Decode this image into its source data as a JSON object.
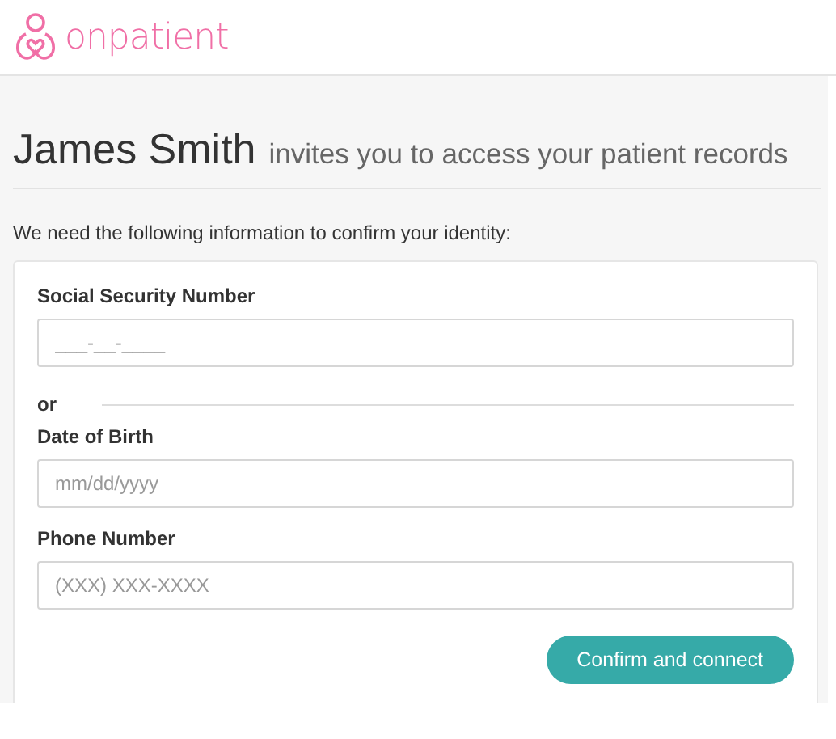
{
  "header": {
    "brand": "onpatient"
  },
  "heading": {
    "name": "James Smith",
    "rest": "invites you to access your patient records"
  },
  "intro": "We need the following information to confirm your identity:",
  "form": {
    "fields": [
      {
        "kind": "field",
        "label": "Social Security Number",
        "placeholder": "___-__-____"
      },
      {
        "kind": "divider",
        "label": "or"
      },
      {
        "kind": "field",
        "label": "Date of Birth",
        "placeholder": "mm/dd/yyyy"
      },
      {
        "kind": "field",
        "label": "Phone Number",
        "placeholder": "(XXX) XXX-XXXX"
      }
    ],
    "button": "Confirm and connect"
  }
}
